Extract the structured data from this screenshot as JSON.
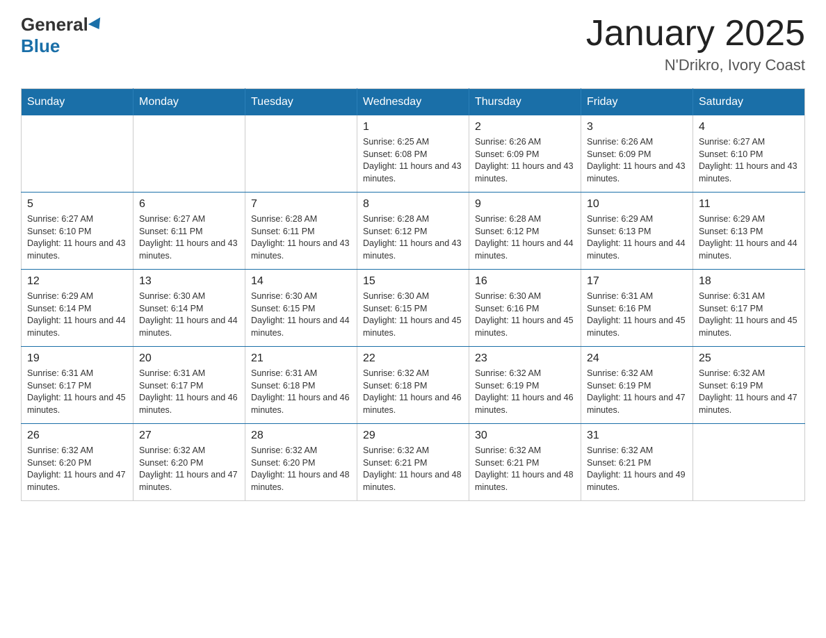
{
  "header": {
    "logo_general": "General",
    "logo_blue": "Blue",
    "month_title": "January 2025",
    "location": "N'Drikro, Ivory Coast"
  },
  "weekdays": [
    "Sunday",
    "Monday",
    "Tuesday",
    "Wednesday",
    "Thursday",
    "Friday",
    "Saturday"
  ],
  "weeks": [
    [
      {
        "day": "",
        "info": ""
      },
      {
        "day": "",
        "info": ""
      },
      {
        "day": "",
        "info": ""
      },
      {
        "day": "1",
        "info": "Sunrise: 6:25 AM\nSunset: 6:08 PM\nDaylight: 11 hours and 43 minutes."
      },
      {
        "day": "2",
        "info": "Sunrise: 6:26 AM\nSunset: 6:09 PM\nDaylight: 11 hours and 43 minutes."
      },
      {
        "day": "3",
        "info": "Sunrise: 6:26 AM\nSunset: 6:09 PM\nDaylight: 11 hours and 43 minutes."
      },
      {
        "day": "4",
        "info": "Sunrise: 6:27 AM\nSunset: 6:10 PM\nDaylight: 11 hours and 43 minutes."
      }
    ],
    [
      {
        "day": "5",
        "info": "Sunrise: 6:27 AM\nSunset: 6:10 PM\nDaylight: 11 hours and 43 minutes."
      },
      {
        "day": "6",
        "info": "Sunrise: 6:27 AM\nSunset: 6:11 PM\nDaylight: 11 hours and 43 minutes."
      },
      {
        "day": "7",
        "info": "Sunrise: 6:28 AM\nSunset: 6:11 PM\nDaylight: 11 hours and 43 minutes."
      },
      {
        "day": "8",
        "info": "Sunrise: 6:28 AM\nSunset: 6:12 PM\nDaylight: 11 hours and 43 minutes."
      },
      {
        "day": "9",
        "info": "Sunrise: 6:28 AM\nSunset: 6:12 PM\nDaylight: 11 hours and 44 minutes."
      },
      {
        "day": "10",
        "info": "Sunrise: 6:29 AM\nSunset: 6:13 PM\nDaylight: 11 hours and 44 minutes."
      },
      {
        "day": "11",
        "info": "Sunrise: 6:29 AM\nSunset: 6:13 PM\nDaylight: 11 hours and 44 minutes."
      }
    ],
    [
      {
        "day": "12",
        "info": "Sunrise: 6:29 AM\nSunset: 6:14 PM\nDaylight: 11 hours and 44 minutes."
      },
      {
        "day": "13",
        "info": "Sunrise: 6:30 AM\nSunset: 6:14 PM\nDaylight: 11 hours and 44 minutes."
      },
      {
        "day": "14",
        "info": "Sunrise: 6:30 AM\nSunset: 6:15 PM\nDaylight: 11 hours and 44 minutes."
      },
      {
        "day": "15",
        "info": "Sunrise: 6:30 AM\nSunset: 6:15 PM\nDaylight: 11 hours and 45 minutes."
      },
      {
        "day": "16",
        "info": "Sunrise: 6:30 AM\nSunset: 6:16 PM\nDaylight: 11 hours and 45 minutes."
      },
      {
        "day": "17",
        "info": "Sunrise: 6:31 AM\nSunset: 6:16 PM\nDaylight: 11 hours and 45 minutes."
      },
      {
        "day": "18",
        "info": "Sunrise: 6:31 AM\nSunset: 6:17 PM\nDaylight: 11 hours and 45 minutes."
      }
    ],
    [
      {
        "day": "19",
        "info": "Sunrise: 6:31 AM\nSunset: 6:17 PM\nDaylight: 11 hours and 45 minutes."
      },
      {
        "day": "20",
        "info": "Sunrise: 6:31 AM\nSunset: 6:17 PM\nDaylight: 11 hours and 46 minutes."
      },
      {
        "day": "21",
        "info": "Sunrise: 6:31 AM\nSunset: 6:18 PM\nDaylight: 11 hours and 46 minutes."
      },
      {
        "day": "22",
        "info": "Sunrise: 6:32 AM\nSunset: 6:18 PM\nDaylight: 11 hours and 46 minutes."
      },
      {
        "day": "23",
        "info": "Sunrise: 6:32 AM\nSunset: 6:19 PM\nDaylight: 11 hours and 46 minutes."
      },
      {
        "day": "24",
        "info": "Sunrise: 6:32 AM\nSunset: 6:19 PM\nDaylight: 11 hours and 47 minutes."
      },
      {
        "day": "25",
        "info": "Sunrise: 6:32 AM\nSunset: 6:19 PM\nDaylight: 11 hours and 47 minutes."
      }
    ],
    [
      {
        "day": "26",
        "info": "Sunrise: 6:32 AM\nSunset: 6:20 PM\nDaylight: 11 hours and 47 minutes."
      },
      {
        "day": "27",
        "info": "Sunrise: 6:32 AM\nSunset: 6:20 PM\nDaylight: 11 hours and 47 minutes."
      },
      {
        "day": "28",
        "info": "Sunrise: 6:32 AM\nSunset: 6:20 PM\nDaylight: 11 hours and 48 minutes."
      },
      {
        "day": "29",
        "info": "Sunrise: 6:32 AM\nSunset: 6:21 PM\nDaylight: 11 hours and 48 minutes."
      },
      {
        "day": "30",
        "info": "Sunrise: 6:32 AM\nSunset: 6:21 PM\nDaylight: 11 hours and 48 minutes."
      },
      {
        "day": "31",
        "info": "Sunrise: 6:32 AM\nSunset: 6:21 PM\nDaylight: 11 hours and 49 minutes."
      },
      {
        "day": "",
        "info": ""
      }
    ]
  ]
}
